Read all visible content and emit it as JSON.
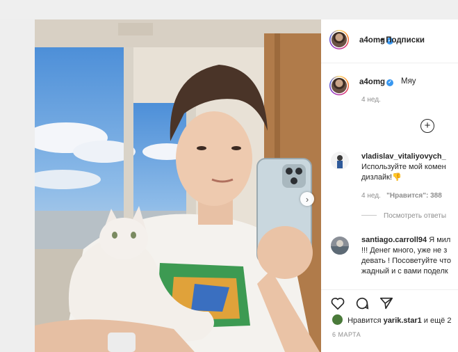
{
  "post": {
    "username": "a4omg",
    "follow_label": "Подписки",
    "follow_separator": "•",
    "caption": "Мяу",
    "caption_age": "4 нед."
  },
  "comments": [
    {
      "username": "vladislav_vitaliyovych_",
      "line1": "Используйте мой комен",
      "line2": "дизлайк!👎",
      "age": "4 нед.",
      "likes": "\"Нравится\": 388",
      "view_replies": "Посмотреть ответы"
    },
    {
      "username": "santiago.carroll94",
      "line1_tail": "Я мил",
      "line2": "!!! Денег много, уже не з",
      "line3": "девать ! Посоветуйте что",
      "line4": "жадный и с вами поделк"
    }
  ],
  "footer": {
    "liked_by_prefix": "Нравится",
    "liked_by_user": "yarik.star1",
    "liked_by_suffix": "и ещё 2",
    "date": "6 МАРТА"
  },
  "icons": [
    "verified-icon",
    "add-comment-icon",
    "heart-icon",
    "comment-icon",
    "share-icon",
    "next-arrow-icon"
  ],
  "colors": {
    "verified": "#3897f0",
    "secondary_text": "#8e8e8e",
    "border": "#efefef"
  }
}
